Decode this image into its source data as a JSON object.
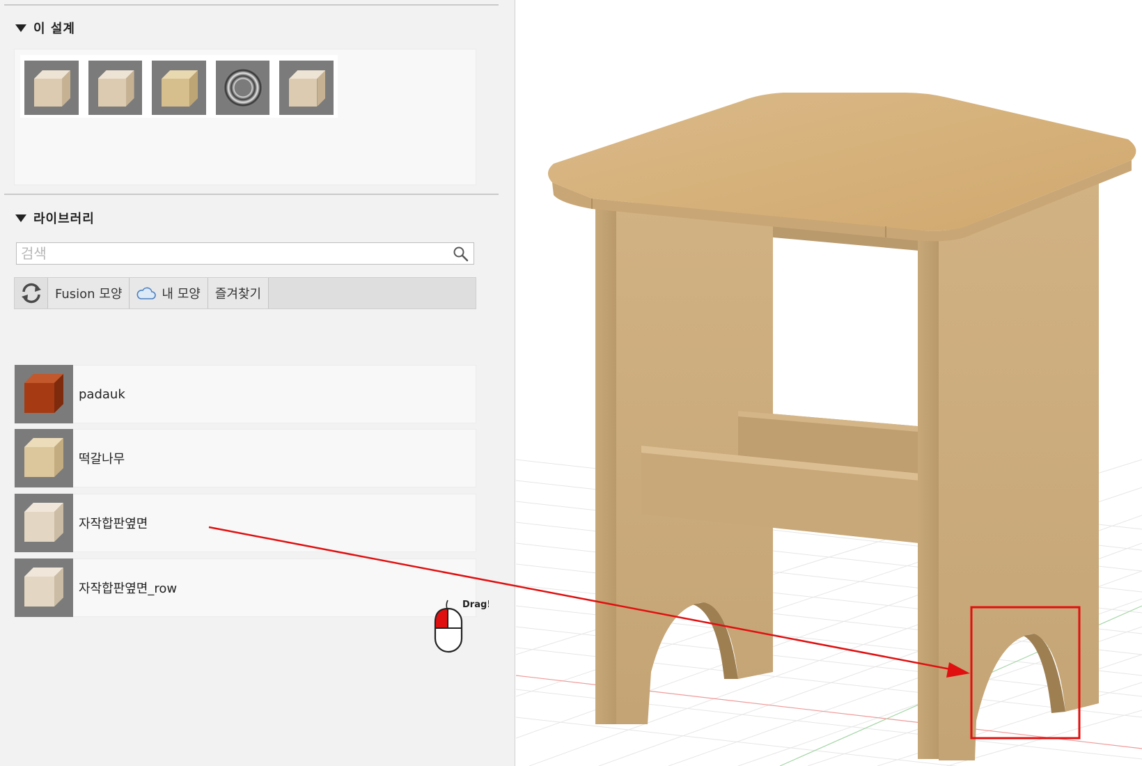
{
  "panel": {
    "this_design": {
      "title": "이 설계",
      "thumbnails": [
        {
          "icon": "light-wood-cube-icon",
          "color": "#dccbb0"
        },
        {
          "icon": "light-wood-cube-icon",
          "color": "#dccbb0"
        },
        {
          "icon": "yellow-wood-cube-icon",
          "color": "#d7bf8d"
        },
        {
          "icon": "chrome-ring-icon",
          "color": "#bdbdbd"
        },
        {
          "icon": "light-wood-cube-icon",
          "color": "#dccbb0"
        }
      ]
    },
    "library": {
      "title": "라이브러리",
      "search_placeholder": "검색",
      "tabs": {
        "refresh_icon": "refresh-icon",
        "fusion": "Fusion 모양",
        "my_appearances": "내 모양",
        "favorites": "즐겨찾기"
      },
      "items": [
        {
          "label": "padauk",
          "color": "#a63a12"
        },
        {
          "label": "떡갈나무",
          "color": "#dcc79c"
        },
        {
          "label": "자작합판옆면",
          "color": "#e3d6c2"
        },
        {
          "label": "자작합판옆면_row",
          "color": "#e3d6c2"
        }
      ]
    },
    "drag_hint": "Drag!"
  },
  "viewport": {
    "model": "wooden-stool",
    "wood_color": "#c9a97a",
    "highlight_color": "#e01010"
  }
}
